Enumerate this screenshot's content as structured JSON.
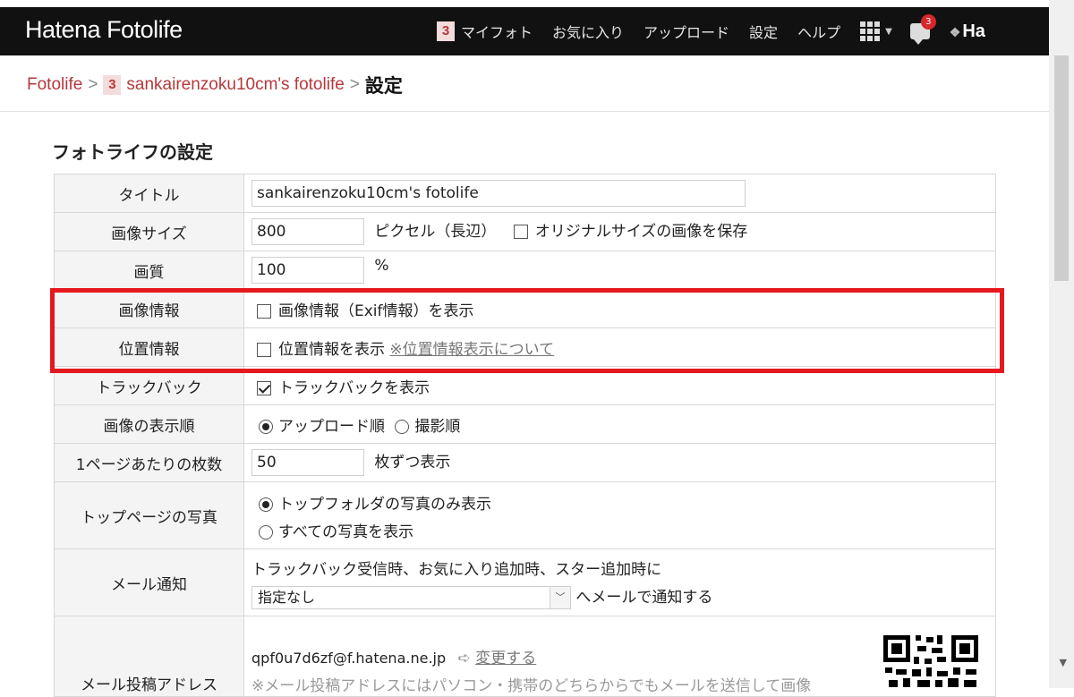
{
  "header": {
    "logo": "Hatena Fotolife",
    "user_badge": "3",
    "nav": [
      "マイフォト",
      "お気に入り",
      "アップロード",
      "設定",
      "ヘルプ"
    ],
    "notification_count": "3",
    "brand_right": "Ha"
  },
  "breadcrumb": {
    "root": "Fotolife",
    "separator": ">",
    "user_badge": "3",
    "user": "sankairenzoku10cm's fotolife",
    "current": "設定"
  },
  "section_title": "フォトライフの設定",
  "settings": {
    "title": {
      "label": "タイトル",
      "value": "sankairenzoku10cm's fotolife"
    },
    "image_size": {
      "label": "画像サイズ",
      "value": "800",
      "unit": "ピクセル（長辺）",
      "original_label": "オリジナルサイズの画像を保存",
      "original_checked": false
    },
    "quality": {
      "label": "画質",
      "value": "100",
      "unit": "%"
    },
    "exif": {
      "label": "画像情報",
      "option": "画像情報（Exif情報）を表示",
      "checked": false
    },
    "location": {
      "label": "位置情報",
      "option": "位置情報を表示",
      "link": "※位置情報表示について",
      "checked": false
    },
    "trackback": {
      "label": "トラックバック",
      "option": "トラックバックを表示",
      "checked": true
    },
    "order": {
      "label": "画像の表示順",
      "option_upload": "アップロード順",
      "option_shot": "撮影順",
      "selected": "アップロード順"
    },
    "per_page": {
      "label": "1ページあたりの枚数",
      "value": "50",
      "unit": "枚ずつ表示"
    },
    "top_photos": {
      "label": "トップページの写真",
      "option_top": "トップフォルダの写真のみ表示",
      "option_all": "すべての写真を表示",
      "selected": "トップフォルダの写真のみ表示"
    },
    "mail_notify": {
      "label": "メール通知",
      "description": "トラックバック受信時、お気に入り追加時、スター追加時に",
      "select_value": "指定なし",
      "suffix": "へメールで通知する"
    },
    "mail_post": {
      "label": "メール投稿アドレス",
      "address": "qpf0u7d6zf@f.hatena.ne.jp",
      "change_link": "変更する",
      "note": "※メール投稿アドレスにはパソコン・携帯のどちらからでもメールを送信して画像"
    }
  },
  "colors": {
    "topbar": "#111111",
    "accent": "#b5383c",
    "highlight": "#e5191d"
  }
}
